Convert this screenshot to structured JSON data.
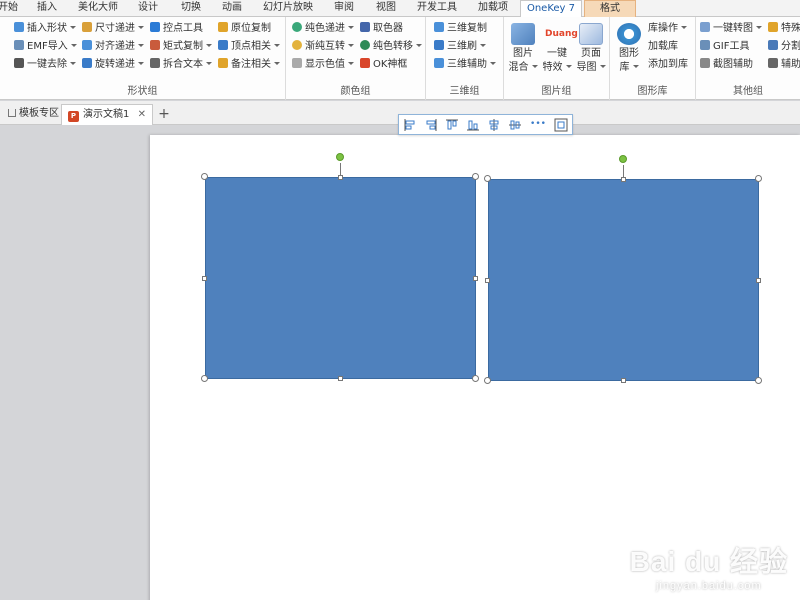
{
  "ribbon_tabs": [
    "开始",
    "插入",
    "美化大师",
    "设计",
    "切换",
    "动画",
    "幻灯片放映",
    "审阅",
    "视图",
    "开发工具",
    "加载项",
    "OneKey 7",
    "格式"
  ],
  "active_tab": "OneKey 7",
  "groups": {
    "shape": {
      "label": "形状组",
      "items": [
        "插入形状",
        "EMF导入",
        "一键去除",
        "尺寸递进",
        "对齐递进",
        "旋转递进",
        "控点工具",
        "矩式复制",
        "拆合文本",
        "原位复制",
        "顶点相关",
        "备注相关"
      ]
    },
    "color": {
      "label": "颜色组",
      "items": [
        "纯色递进",
        "渐纯互转",
        "显示色值",
        "取色器",
        "纯色转移",
        "OK神框"
      ]
    },
    "threed": {
      "label": "三维组",
      "items": [
        "三维复制",
        "三维刷",
        "三维辅助"
      ]
    },
    "image": {
      "label": "图片组",
      "big": [
        {
          "line1": "图片",
          "line2": "混合"
        },
        {
          "line1": "一键",
          "line2": "特效"
        },
        {
          "line1": "页面",
          "line2": "导图"
        }
      ],
      "duang": "Duang"
    },
    "library": {
      "label": "图形库",
      "big": {
        "line1": "图形",
        "line2": "库"
      },
      "items": [
        "库操作",
        "加载库",
        "添加到库"
      ]
    },
    "other": {
      "label": "其他组",
      "items": [
        "一键转图",
        "GIF工具",
        "截图辅助",
        "特殊",
        "分割",
        "辅助"
      ]
    }
  },
  "doc_tabs": {
    "template": "模板专区",
    "doc": "演示文稿1",
    "close": "✕",
    "add": "+"
  },
  "align_toolbar": {
    "buttons": [
      "align-left",
      "align-right",
      "align-top",
      "align-bottom",
      "align-center-horizontal",
      "align-center-vertical",
      "more",
      "distribute"
    ],
    "more_label": "•••"
  },
  "colors": {
    "shape_fill": "#4f81bd",
    "active_tab": "#1a5aa6",
    "context_tab": "#f6d9b8",
    "rotation_handle": "#7cc243"
  },
  "watermark": {
    "main": "Bai du 经验",
    "sub": "jingyan.baidu.com"
  }
}
